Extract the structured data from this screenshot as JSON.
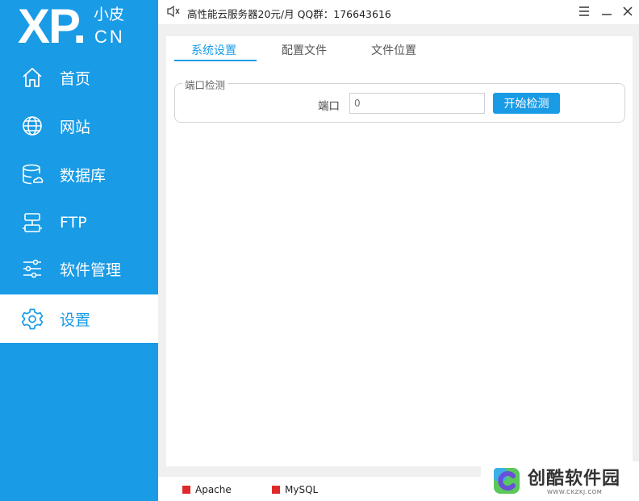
{
  "logo": {
    "main": "XP",
    "dot": ".",
    "small": "小皮",
    "cn": "CN"
  },
  "sidebar": {
    "items": [
      {
        "label": "首页",
        "icon": "home-icon"
      },
      {
        "label": "网站",
        "icon": "globe-icon"
      },
      {
        "label": "数据库",
        "icon": "database-icon"
      },
      {
        "label": "FTP",
        "icon": "ftp-server-icon"
      },
      {
        "label": "软件管理",
        "icon": "sliders-icon"
      },
      {
        "label": "设置",
        "icon": "gear-icon",
        "active": true
      }
    ]
  },
  "topbar": {
    "notice": "高性能云服务器20元/月   QQ群：176643616"
  },
  "tabs": [
    {
      "label": "系统设置",
      "active": true
    },
    {
      "label": "配置文件"
    },
    {
      "label": "文件位置"
    }
  ],
  "port_check": {
    "group_title": "端口检测",
    "port_label": "端口",
    "port_placeholder": "0",
    "button_label": "开始检测"
  },
  "status": {
    "items": [
      {
        "label": "Apache",
        "color": "#e02a2a"
      },
      {
        "label": "MySQL",
        "color": "#e02a2a"
      }
    ]
  },
  "watermark": {
    "title": "创酷软件园",
    "url": "WWW.CKZKJ.COM"
  },
  "colors": {
    "accent": "#1a9be6",
    "stopped": "#e02a2a"
  }
}
